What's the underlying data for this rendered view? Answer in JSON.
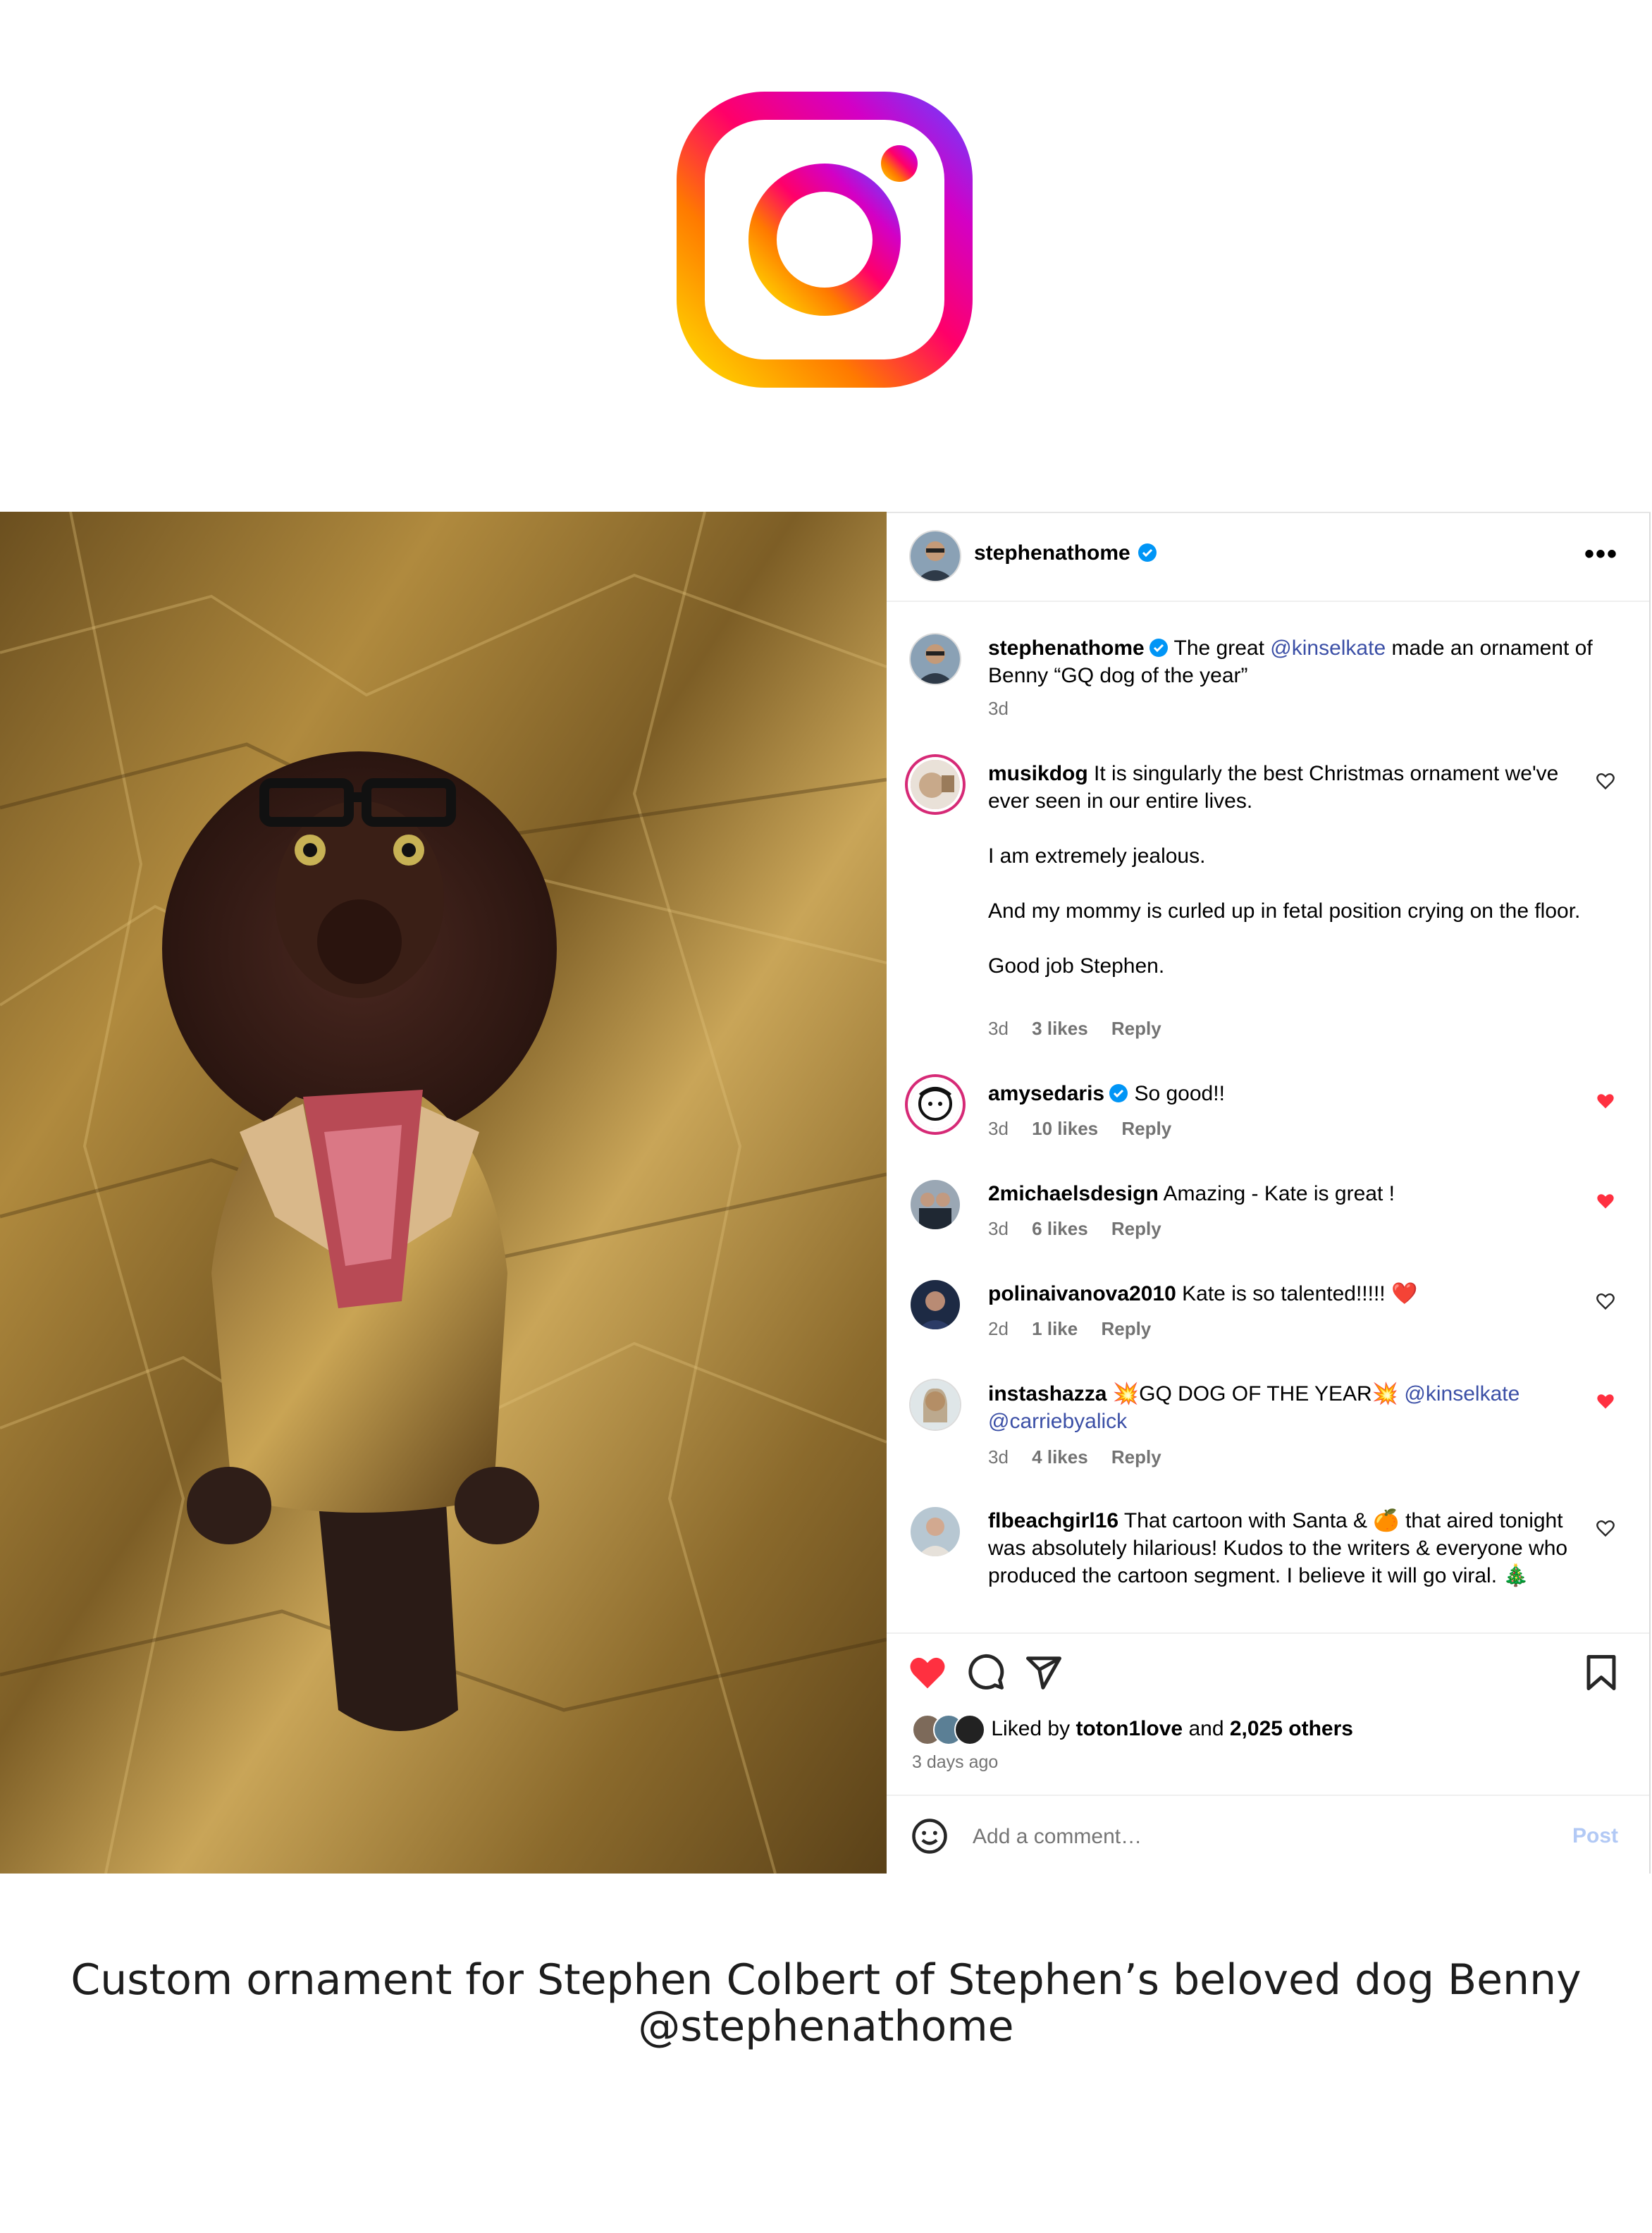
{
  "post": {
    "author": "stephenathome",
    "caption_text": "The great",
    "caption_mention": "@kinselkate",
    "caption_rest": "made an ornament of Benny “GQ dog of the year”",
    "caption_time": "3d",
    "more_label": "•••"
  },
  "comments": [
    {
      "user": "musikdog",
      "text": "It is singularly the best Christmas ornament we've ever seen in our entire lives.",
      "p2": "I am extremely jealous.",
      "p3": "And my mommy is curled up in fetal position crying on the floor.",
      "p4": "Good job Stephen.",
      "time": "3d",
      "likes": "3 likes",
      "reply": "Reply",
      "liked": false
    },
    {
      "user": "amysedaris",
      "text": "So good!!",
      "time": "3d",
      "likes": "10 likes",
      "reply": "Reply",
      "liked": true
    },
    {
      "user": "2michaelsdesign",
      "text": "Amazing - Kate is great !",
      "time": "3d",
      "likes": "6 likes",
      "reply": "Reply",
      "liked": true
    },
    {
      "user": "polinaivanova2010",
      "text": "Kate is so talented!!!!! ❤️",
      "time": "2d",
      "likes": "1 like",
      "reply": "Reply",
      "liked": false
    },
    {
      "user": "instashazza",
      "text_a": "💥GQ DOG OF THE YEAR💥",
      "mention1": "@kinselkate",
      "mention2": "@carriebyalick",
      "time": "3d",
      "likes": "4 likes",
      "reply": "Reply",
      "liked": true
    },
    {
      "user": "flbeachgirl16",
      "text": "That cartoon with Santa & 🍊 that aired tonight was absolutely hilarious! Kudos to the writers & everyone who produced the cartoon segment. I believe it will go viral. 🎄"
    }
  ],
  "likes": {
    "prefix": "Liked by",
    "user": "toton1love",
    "mid": "and",
    "count": "2,025 others"
  },
  "posted_ago": "3 days ago",
  "comment_box": {
    "placeholder": "Add a comment…",
    "post_label": "Post"
  },
  "page_caption": {
    "line1": "Custom ornament for Stephen Colbert of Stephen’s beloved dog Benny",
    "line2": "@stephenathome"
  },
  "colors": {
    "heart_red": "#ff3040",
    "mention": "#3b4fa6",
    "verified": "#0095f6",
    "post_disabled": "#b2c9f5"
  }
}
